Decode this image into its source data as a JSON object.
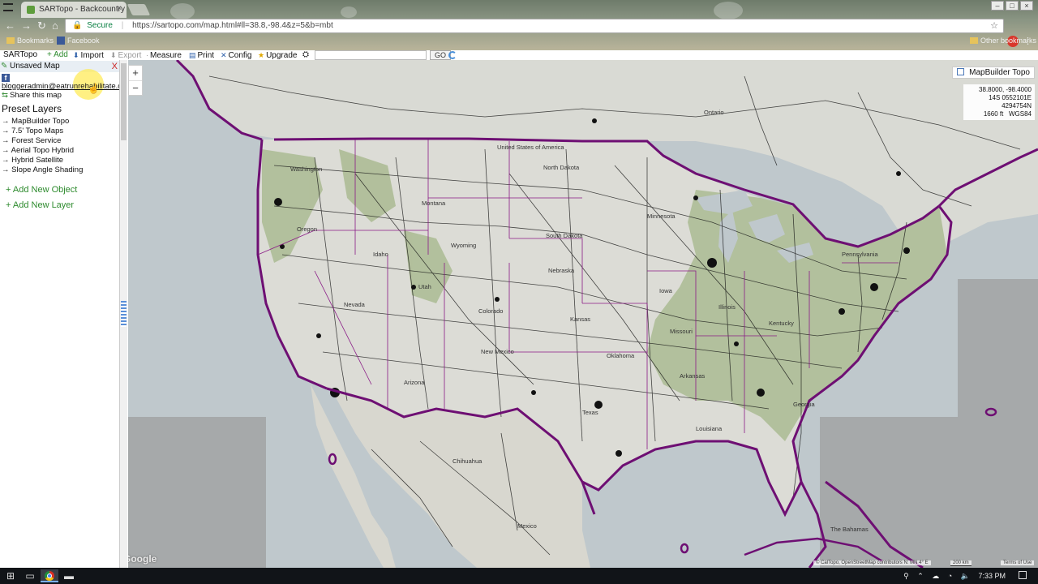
{
  "browser": {
    "tab_title": "SARTopo - Backcountry",
    "tab_close": "×",
    "secure_label": "Secure",
    "url": "https://sartopo.com/map.html#ll=38.8,-98.4&z=5&b=mbt",
    "bookmarks": [
      {
        "label": "Bookmarks"
      },
      {
        "label": "Facebook"
      }
    ],
    "other_bookmarks": "Other bookmarks",
    "nav": {
      "back": "←",
      "forward": "→",
      "reload": "↻",
      "home": "⌂"
    },
    "star": "☆"
  },
  "toolbar": {
    "brand": "SARTopo",
    "add": "+ Add",
    "import": "Import",
    "export": "Export",
    "measure": "Measure",
    "print": "Print",
    "config": "Config",
    "upgrade": "Upgrade",
    "go": "GO",
    "address_value": ""
  },
  "panel": {
    "title": "Unsaved Map",
    "close": "X",
    "email": "bloggeradmin@eatrunrehabilitate.com",
    "share": "Share this map",
    "preset_heading": "Preset Layers",
    "layers": [
      {
        "label": "→ MapBuilder Topo"
      },
      {
        "label": "→ 7.5' Topo Maps"
      },
      {
        "label": "→ Forest Service"
      },
      {
        "label": "→ Aerial Topo Hybrid"
      },
      {
        "label": "→ Hybrid Satellite"
      },
      {
        "label": "→ Slope Angle Shading"
      }
    ],
    "add_object": "+ Add New Object",
    "add_layer": "+ Add New Layer"
  },
  "map": {
    "zoom_in": "+",
    "zoom_out": "−",
    "basemap": "MapBuilder Topo",
    "coords": {
      "latlng": "38.8000, -98.4000",
      "utm": "14S 0552101E 4294754N",
      "elevation": "1660 ft",
      "datum": "WGS84"
    },
    "labels": [
      {
        "text": "Ontario"
      },
      {
        "text": "United States of America"
      },
      {
        "text": "North Dakota"
      },
      {
        "text": "South Dakota"
      },
      {
        "text": "Montana"
      },
      {
        "text": "Wyoming"
      },
      {
        "text": "Idaho"
      },
      {
        "text": "Oregon"
      },
      {
        "text": "Washington"
      },
      {
        "text": "Nevada"
      },
      {
        "text": "Utah"
      },
      {
        "text": "Colorado"
      },
      {
        "text": "Nebraska"
      },
      {
        "text": "Kansas"
      },
      {
        "text": "Arizona"
      },
      {
        "text": "New Mexico"
      },
      {
        "text": "Texas"
      },
      {
        "text": "Mexico"
      },
      {
        "text": "Chihuahua"
      },
      {
        "text": "The Bahamas"
      },
      {
        "text": "Minnesota"
      },
      {
        "text": "Iowa"
      },
      {
        "text": "Illinois"
      },
      {
        "text": "Missouri"
      },
      {
        "text": "Oklahoma"
      },
      {
        "text": "Arkansas"
      },
      {
        "text": "Kentucky"
      },
      {
        "text": "Georgia"
      },
      {
        "text": "Pennsylvania"
      },
      {
        "text": "Louisiana"
      }
    ],
    "google": "Google",
    "attribution": "© CalTopo, OpenStreetMap contributors  N: MN 4° E",
    "scale": "200 km",
    "terms": "Terms of Use"
  },
  "taskbar": {
    "start": "⊞",
    "time": "7:33 PM"
  },
  "colors": {
    "state_border": "#8a1a86",
    "national_border": "#6e0f73",
    "vegetation": "#9bb07e",
    "land": "#dcdcd6",
    "water": "#bcc7cb",
    "roads": "#111111"
  }
}
